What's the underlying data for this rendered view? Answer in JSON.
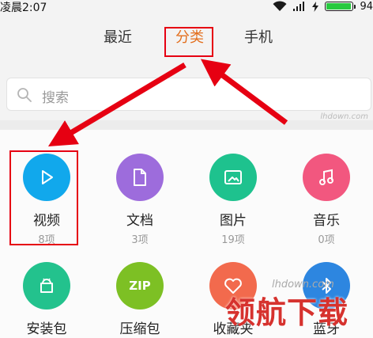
{
  "status_bar": {
    "time": "凌晨2:07",
    "battery": "94"
  },
  "tabs": [
    {
      "label": "最近"
    },
    {
      "label": "分类",
      "active": true
    },
    {
      "label": "手机"
    }
  ],
  "search": {
    "placeholder": "搜索"
  },
  "watermark_small": "lhdown.com",
  "categories": [
    {
      "label": "视频",
      "count": "8项",
      "color": "#11a8ec",
      "icon": "play-icon"
    },
    {
      "label": "文档",
      "count": "3项",
      "color": "#9d6cdc",
      "icon": "document-icon"
    },
    {
      "label": "图片",
      "count": "19项",
      "color": "#1ec28e",
      "icon": "image-icon"
    },
    {
      "label": "音乐",
      "count": "0项",
      "color": "#f2577f",
      "icon": "music-icon"
    },
    {
      "label": "安装包",
      "color": "#23c28d",
      "icon": "android-package-icon"
    },
    {
      "label": "压缩包",
      "color": "#7dc024",
      "icon": "zip-icon"
    },
    {
      "label": "收藏夹",
      "color": "#f26a4d",
      "icon": "heart-icon"
    },
    {
      "label": "蓝牙",
      "color": "#2d86e0",
      "icon": "bluetooth-icon"
    }
  ],
  "watermark_big": "领航下载",
  "watermark_net": "lhdown.com",
  "colors": {
    "accent": "#e36f1e",
    "annotation": "#e60012"
  }
}
